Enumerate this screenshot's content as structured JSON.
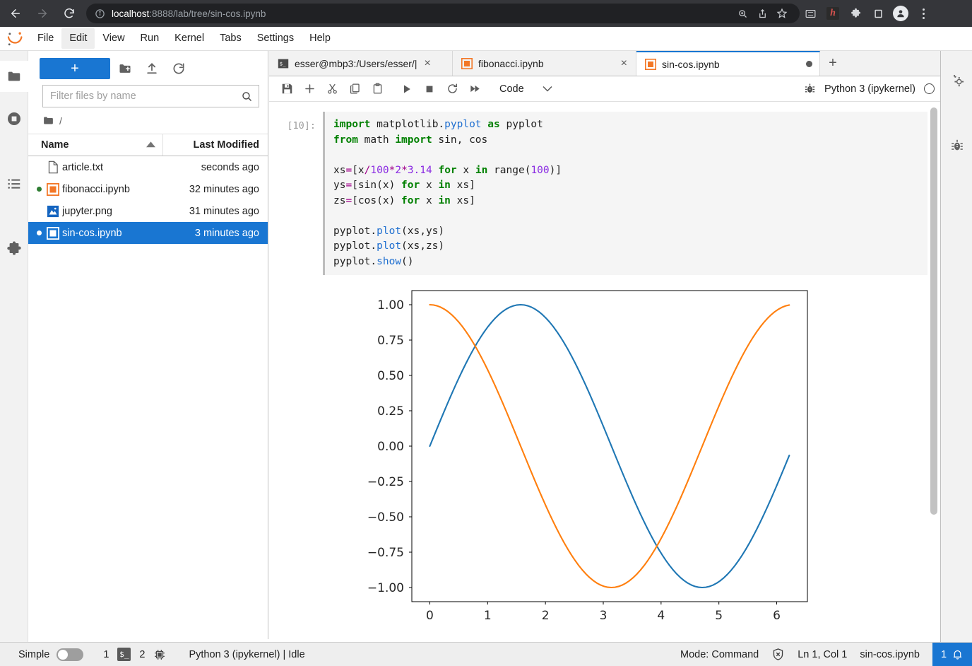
{
  "browser": {
    "back_icon": "arrow-left-icon",
    "forward_icon": "arrow-right-icon",
    "reload_icon": "reload-icon",
    "site_info_icon": "info-circle-icon",
    "url_host": "localhost",
    "url_rest": ":8888/lab/tree/sin-cos.ipynb",
    "url_full": "localhost:8888/lab/tree/sin-cos.ipynb",
    "omnibox_actions": [
      "zoom-icon",
      "share-icon",
      "bookmark-star-icon"
    ],
    "toolbar_icons": [
      "media-cast-icon",
      "extension-h-icon",
      "extensions-puzzle-icon",
      "reading-list-icon",
      "profile-avatar-icon",
      "chrome-menu-icon"
    ],
    "extension_letter": "h"
  },
  "menubar": {
    "logo": "jupyter-logo-icon",
    "items": [
      {
        "label": "File",
        "active": false
      },
      {
        "label": "Edit",
        "active": true
      },
      {
        "label": "View",
        "active": false
      },
      {
        "label": "Run",
        "active": false
      },
      {
        "label": "Kernel",
        "active": false
      },
      {
        "label": "Tabs",
        "active": false
      },
      {
        "label": "Settings",
        "active": false
      },
      {
        "label": "Help",
        "active": false
      }
    ]
  },
  "left_rail": {
    "items": [
      {
        "name": "file-browser-icon",
        "selected": true
      },
      {
        "name": "running-terminals-icon",
        "selected": false
      },
      {
        "name": "table-of-contents-icon",
        "selected": false
      },
      {
        "name": "extension-manager-icon",
        "selected": false
      }
    ]
  },
  "filebrowser": {
    "new_launcher_label": "+",
    "new_folder_icon": "new-folder-icon",
    "upload_icon": "upload-icon",
    "refresh_icon": "refresh-icon",
    "filter_placeholder": "Filter files by name",
    "filter_value": "",
    "search_icon": "search-icon",
    "breadcrumb_icon": "folder-icon",
    "breadcrumb": "/",
    "columns": [
      "Name",
      "Last Modified"
    ],
    "sort_caret": "caret-up-icon",
    "files": [
      {
        "name": "article.txt",
        "modified": "seconds ago",
        "icon": "text-file-icon",
        "running": false,
        "selected": false
      },
      {
        "name": "fibonacci.ipynb",
        "modified": "32 minutes ago",
        "icon": "notebook-icon",
        "running": true,
        "selected": false
      },
      {
        "name": "jupyter.png",
        "modified": "31 minutes ago",
        "icon": "image-file-icon",
        "running": false,
        "selected": false
      },
      {
        "name": "sin-cos.ipynb",
        "modified": "3 minutes ago",
        "icon": "notebook-icon",
        "running": true,
        "selected": true
      }
    ]
  },
  "dock": {
    "tabs": [
      {
        "label": "esser@mbp3:/Users/esser/|",
        "icon": "terminal-icon",
        "active": false,
        "dirty": false,
        "close": "×"
      },
      {
        "label": "fibonacci.ipynb",
        "icon": "notebook-icon",
        "active": false,
        "dirty": false,
        "close": "×"
      },
      {
        "label": "sin-cos.ipynb",
        "icon": "notebook-icon",
        "active": true,
        "dirty": true,
        "close": ""
      }
    ],
    "add_tab_label": "+"
  },
  "notebook_toolbar": {
    "buttons": [
      {
        "name": "save-icon"
      },
      {
        "name": "insert-cell-icon"
      },
      {
        "name": "cut-icon"
      },
      {
        "name": "copy-icon"
      },
      {
        "name": "paste-icon"
      },
      {
        "name": "run-icon"
      },
      {
        "name": "interrupt-icon"
      },
      {
        "name": "restart-icon"
      },
      {
        "name": "restart-run-all-icon"
      }
    ],
    "cell_type": "Code",
    "cell_type_caret": "chevron-down-icon",
    "debugger_icon": "bug-icon",
    "kernel_name": "Python 3 (ipykernel)",
    "kernel_status_icon": "kernel-idle-circle"
  },
  "cell": {
    "prompt": "[10]:",
    "code_lines": [
      [
        {
          "t": "import",
          "c": "kw"
        },
        {
          "t": " matplotlib.",
          "c": "pl"
        },
        {
          "t": "pyplot",
          "c": "fn"
        },
        {
          "t": " ",
          "c": "pl"
        },
        {
          "t": "as",
          "c": "kw"
        },
        {
          "t": " pyplot",
          "c": "pl"
        }
      ],
      [
        {
          "t": "from",
          "c": "kw"
        },
        {
          "t": " math ",
          "c": "pl"
        },
        {
          "t": "import",
          "c": "kw"
        },
        {
          "t": " sin, cos",
          "c": "pl"
        }
      ],
      [],
      [
        {
          "t": "xs",
          "c": "pl"
        },
        {
          "t": "=",
          "c": "op"
        },
        {
          "t": "[x",
          "c": "pl"
        },
        {
          "t": "/",
          "c": "op"
        },
        {
          "t": "100",
          "c": "num"
        },
        {
          "t": "*",
          "c": "op"
        },
        {
          "t": "2",
          "c": "num"
        },
        {
          "t": "*",
          "c": "op"
        },
        {
          "t": "3.14",
          "c": "num"
        },
        {
          "t": " ",
          "c": "pl"
        },
        {
          "t": "for",
          "c": "kw"
        },
        {
          "t": " x ",
          "c": "pl"
        },
        {
          "t": "in",
          "c": "kw"
        },
        {
          "t": " range(",
          "c": "pl"
        },
        {
          "t": "100",
          "c": "num"
        },
        {
          "t": ")]",
          "c": "pl"
        }
      ],
      [
        {
          "t": "ys",
          "c": "pl"
        },
        {
          "t": "=",
          "c": "op"
        },
        {
          "t": "[sin(x) ",
          "c": "pl"
        },
        {
          "t": "for",
          "c": "kw"
        },
        {
          "t": " x ",
          "c": "pl"
        },
        {
          "t": "in",
          "c": "kw"
        },
        {
          "t": " xs]",
          "c": "pl"
        }
      ],
      [
        {
          "t": "zs",
          "c": "pl"
        },
        {
          "t": "=",
          "c": "op"
        },
        {
          "t": "[cos(x) ",
          "c": "pl"
        },
        {
          "t": "for",
          "c": "kw"
        },
        {
          "t": " x ",
          "c": "pl"
        },
        {
          "t": "in",
          "c": "kw"
        },
        {
          "t": " xs]",
          "c": "pl"
        }
      ],
      [],
      [
        {
          "t": "pyplot.",
          "c": "pl"
        },
        {
          "t": "plot",
          "c": "fn"
        },
        {
          "t": "(xs,ys)",
          "c": "pl"
        }
      ],
      [
        {
          "t": "pyplot.",
          "c": "pl"
        },
        {
          "t": "plot",
          "c": "fn"
        },
        {
          "t": "(xs,zs)",
          "c": "pl"
        }
      ],
      [
        {
          "t": "pyplot.",
          "c": "pl"
        },
        {
          "t": "show",
          "c": "fn"
        },
        {
          "t": "()",
          "c": "pl"
        }
      ]
    ],
    "code_text": "import matplotlib.pyplot as pyplot\nfrom math import sin, cos\n\nxs=[x/100*2*3.14 for x in range(100)]\nys=[sin(x) for x in xs]\nzs=[cos(x) for x in xs]\n\npyplot.plot(xs,ys)\npyplot.plot(xs,zs)\npyplot.show()"
  },
  "chart_data": {
    "type": "line",
    "title": "",
    "xlabel": "",
    "ylabel": "",
    "xlim": [
      -0.311,
      6.531
    ],
    "ylim": [
      -1.1,
      1.1
    ],
    "xticks": [
      "0",
      "1",
      "2",
      "3",
      "4",
      "5",
      "6"
    ],
    "xtick_values": [
      0,
      1,
      2,
      3,
      4,
      5,
      6
    ],
    "yticks": [
      "1.00",
      "0.75",
      "0.50",
      "0.25",
      "0.00",
      "−0.25",
      "−0.50",
      "−0.75",
      "−1.00"
    ],
    "ytick_values": [
      1.0,
      0.75,
      0.5,
      0.25,
      0.0,
      -0.25,
      -0.5,
      -0.75,
      -1.0
    ],
    "grid": false,
    "legend": "none",
    "x_domain_note": "x = i/100*2*3.14 for i in range(100), i.e. 0 to 6.2028",
    "series": [
      {
        "name": "sin(x)",
        "color": "#1f77b4",
        "function": "sin",
        "n_points": 100,
        "x_start": 0.0,
        "x_end": 6.2028,
        "y_start": 0.0,
        "y_end": -0.0804
      },
      {
        "name": "cos(x)",
        "color": "#ff7f0e",
        "function": "cos",
        "n_points": 100,
        "x_start": 0.0,
        "x_end": 6.2028,
        "y_start": 1.0,
        "y_end": 0.9968
      }
    ]
  },
  "right_rail": {
    "items": [
      {
        "name": "property-inspector-icon"
      },
      {
        "name": "debugger-icon"
      }
    ]
  },
  "statusbar": {
    "simple_label": "Simple",
    "simple_toggle_on": false,
    "kernel_count": "1",
    "terminal_icon": "terminal-badge-icon",
    "terminal_count": "2",
    "cpu_icon": "kernel-chip-icon",
    "kernel_info": "Python 3 (ipykernel) | Idle",
    "mode": "Mode: Command",
    "shield_icon": "no-trust-shield-icon",
    "cursor_position": "Ln 1, Col 1",
    "filename": "sin-cos.ipynb",
    "notification_count": "1",
    "notification_icon": "bell-icon"
  }
}
